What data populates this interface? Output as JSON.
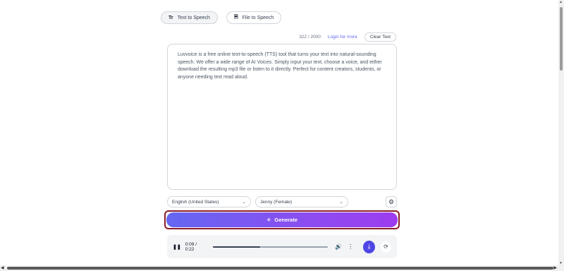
{
  "tabs": [
    {
      "label": "Text to Speech",
      "icon": "text-type-icon",
      "active": true
    },
    {
      "label": "File to Speech",
      "icon": "file-icon",
      "active": false
    }
  ],
  "meta": {
    "char_count": "322 / 2000",
    "login_link": "Login for more",
    "clear_label": "Clear Text"
  },
  "editor": {
    "text": "Luvvoice is a free online text-to-speech (TTS) tool that turns your text into natural-sounding speech. We offer a wide range of AI Voices. Simply input your text, choose a voice, and either download the resulting mp3 file or listen to it directly. Perfect for content creators, students, or anyone needing text read aloud."
  },
  "selects": {
    "language": "English (United States)",
    "voice": "Jenny (Female)"
  },
  "generate": {
    "label": "Generate"
  },
  "player": {
    "time": "0:09 / 0:22",
    "progress": 0.41
  },
  "colors": {
    "accent": "#4f46e5",
    "gradient_start": "#6467f2",
    "gradient_end": "#9d3cef",
    "highlight_border": "#8b1c2b",
    "link": "#6366f1"
  }
}
